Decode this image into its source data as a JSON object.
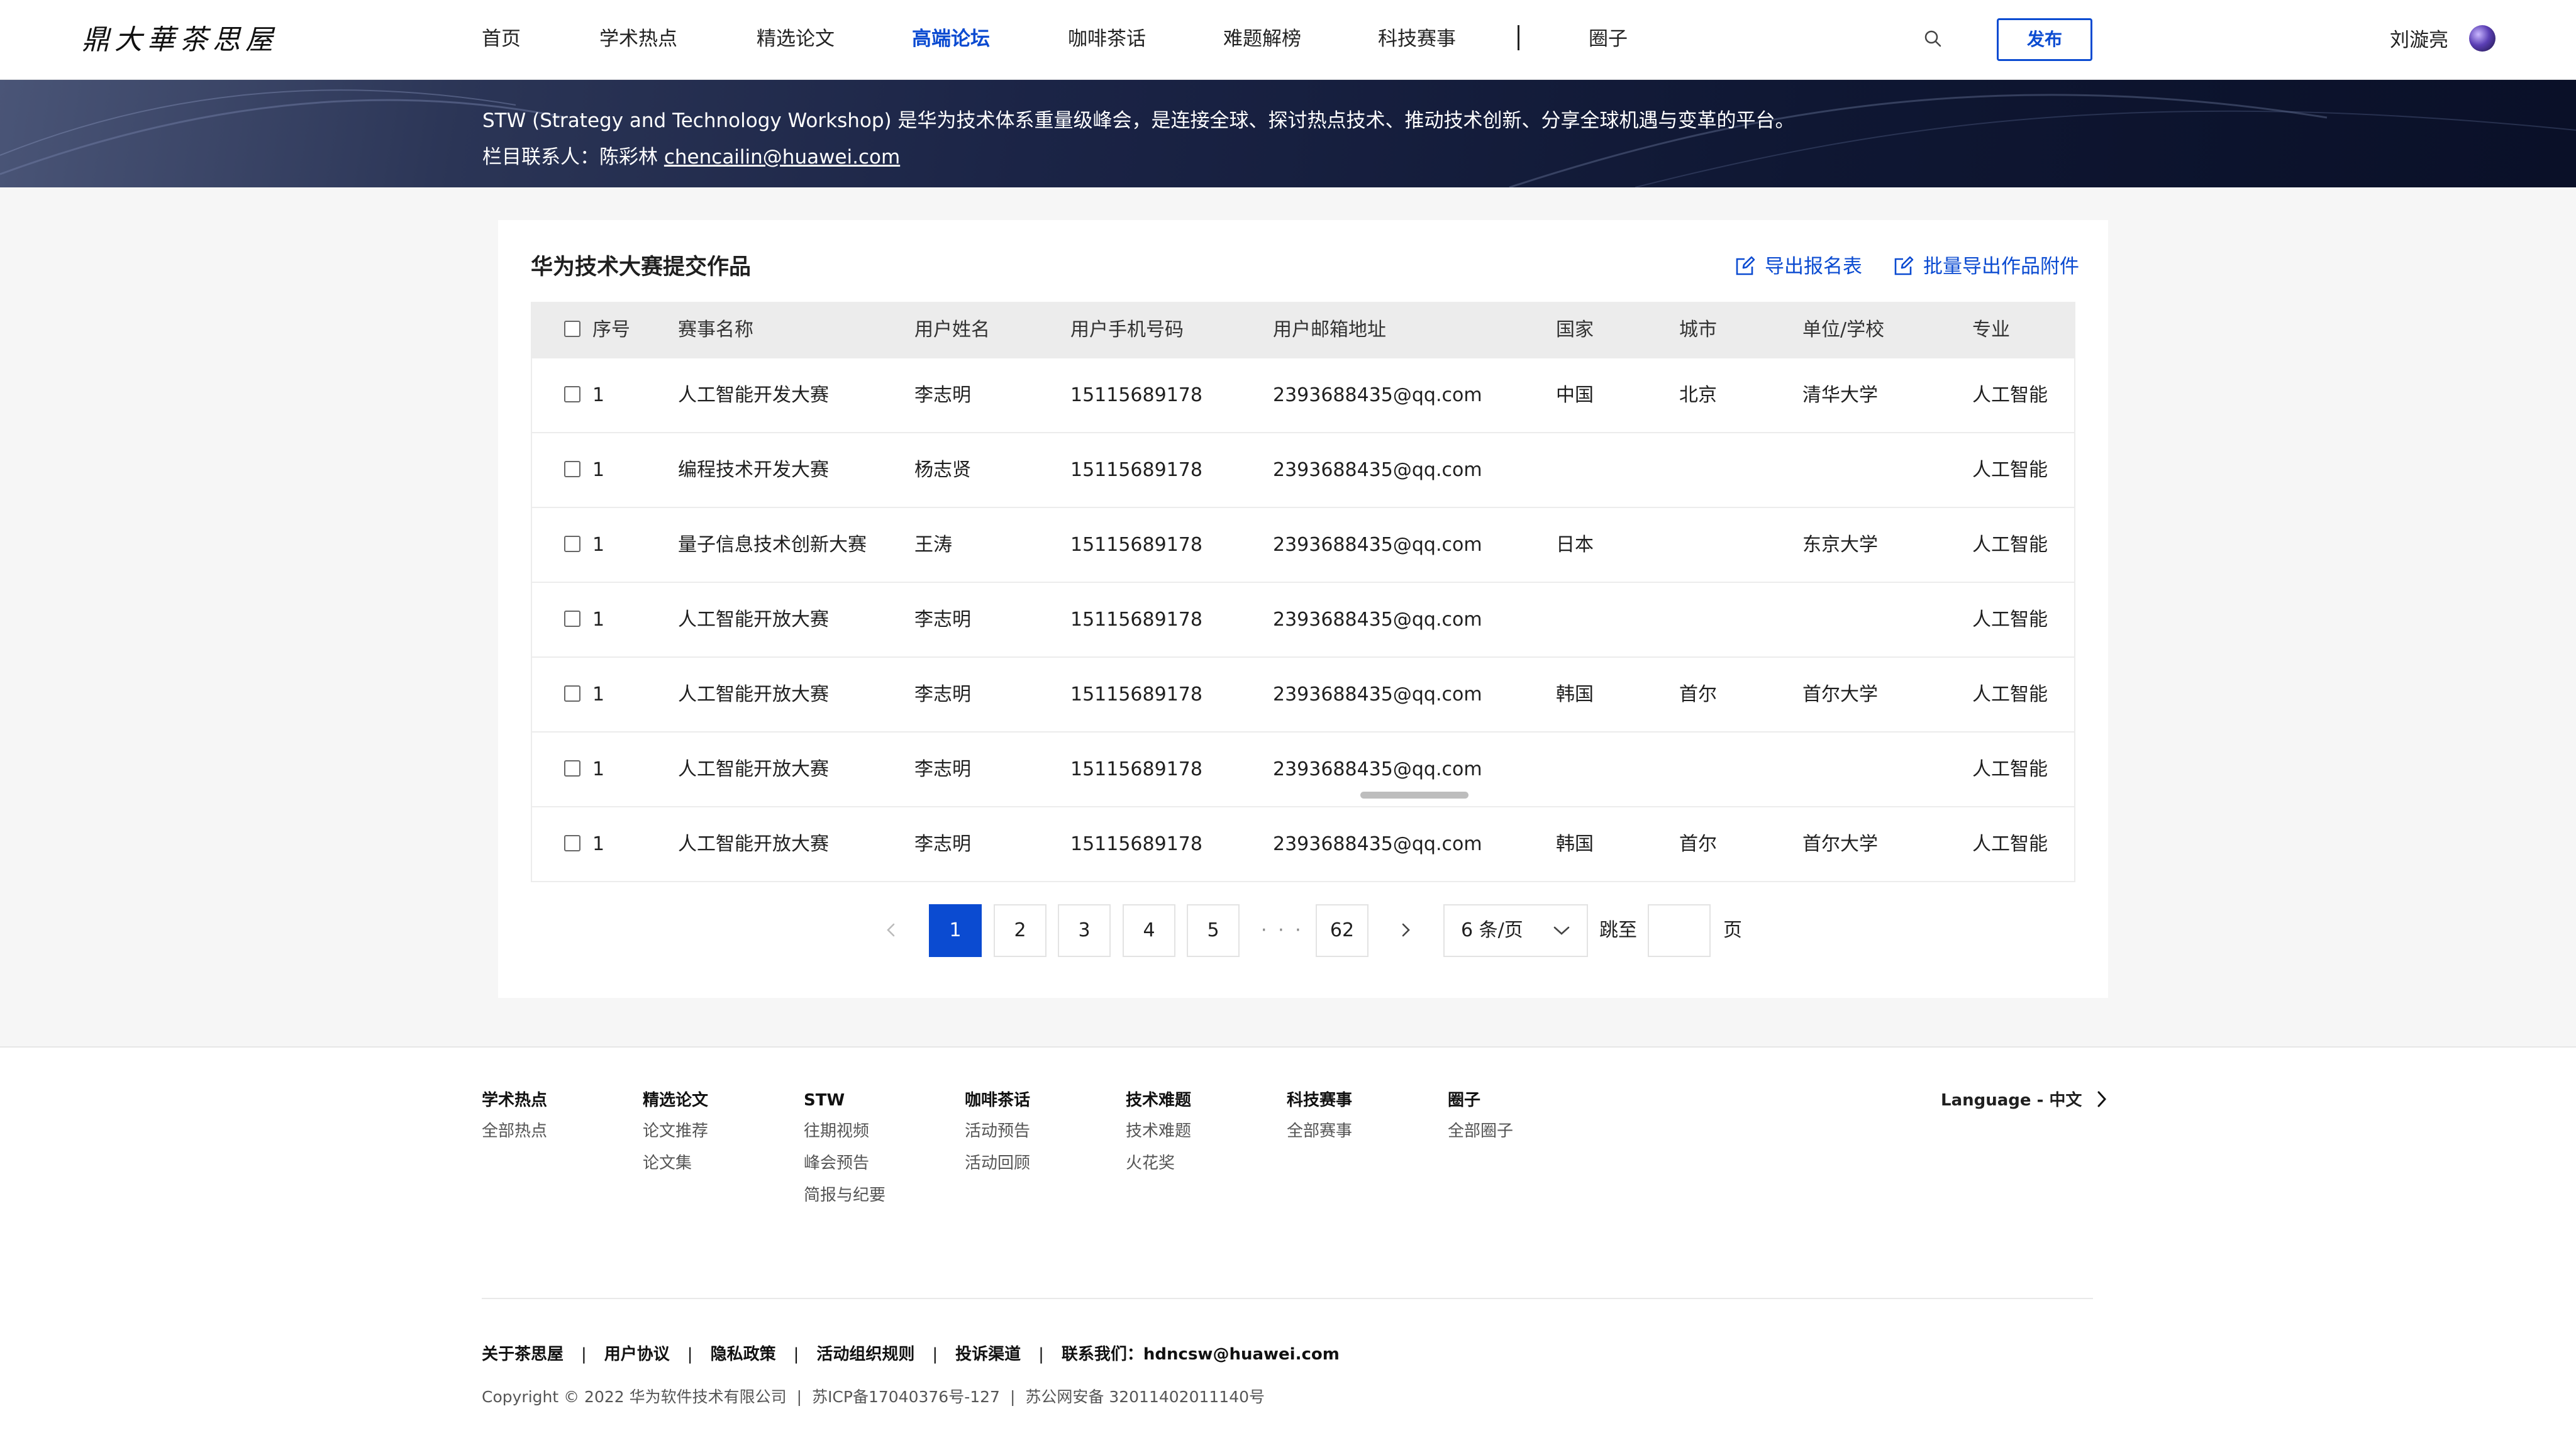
{
  "brand": {
    "logo_text": "鼎大華茶思屋"
  },
  "nav": {
    "items": [
      {
        "label": "首页"
      },
      {
        "label": "学术热点"
      },
      {
        "label": "精选论文"
      },
      {
        "label": "高端论坛",
        "active": true
      },
      {
        "label": "咖啡茶话"
      },
      {
        "label": "难题解榜"
      },
      {
        "label": "科技赛事"
      },
      {
        "label": "圈子"
      }
    ],
    "publish_label": "发布",
    "user_name": "刘漩亮"
  },
  "banner": {
    "description": "STW (Strategy and Technology Workshop) 是华为技术体系重量级峰会，是连接全球、探讨热点技术、推动技术创新、分享全球机遇与变革的平台。",
    "contact_label": "栏目联系人：陈彩林 ",
    "contact_email": "chencailin@huawei.com"
  },
  "card": {
    "title": "华为技术大赛提交作品",
    "export_registration": "导出报名表",
    "export_attachments": "批量导出作品附件"
  },
  "table": {
    "headers": [
      "序号",
      "赛事名称",
      "用户姓名",
      "用户手机号码",
      "用户邮箱地址",
      "国家",
      "城市",
      "单位/学校",
      "专业"
    ],
    "rows": [
      [
        "1",
        "人工智能开发大赛",
        "李志明",
        "15115689178",
        "2393688435@qq.com",
        "中国",
        "北京",
        "清华大学",
        "人工智能"
      ],
      [
        "1",
        "编程技术开发大赛",
        "杨志贤",
        "15115689178",
        "2393688435@qq.com",
        "",
        "",
        "",
        "人工智能"
      ],
      [
        "1",
        "量子信息技术创新大赛",
        "王涛",
        "15115689178",
        "2393688435@qq.com",
        "日本",
        "",
        "东京大学",
        "人工智能"
      ],
      [
        "1",
        "人工智能开放大赛",
        "李志明",
        "15115689178",
        "2393688435@qq.com",
        "",
        "",
        "",
        "人工智能"
      ],
      [
        "1",
        "人工智能开放大赛",
        "李志明",
        "15115689178",
        "2393688435@qq.com",
        "韩国",
        "首尔",
        "首尔大学",
        "人工智能"
      ],
      [
        "1",
        "人工智能开放大赛",
        "李志明",
        "15115689178",
        "2393688435@qq.com",
        "",
        "",
        "",
        "人工智能"
      ],
      [
        "1",
        "人工智能开放大赛",
        "李志明",
        "15115689178",
        "2393688435@qq.com",
        "韩国",
        "首尔",
        "首尔大学",
        "人工智能"
      ]
    ]
  },
  "pagination": {
    "pages": [
      "1",
      "2",
      "3",
      "4",
      "5"
    ],
    "ellipsis": "· · ·",
    "last_page": "62",
    "current_page": 1,
    "page_size": "6 条/页",
    "jump_prefix": "跳至",
    "jump_suffix": "页",
    "jump_value": ""
  },
  "footer": {
    "columns": [
      {
        "heading": "学术热点",
        "links": [
          "全部热点"
        ]
      },
      {
        "heading": "精选论文",
        "links": [
          "论文推荐",
          "论文集"
        ]
      },
      {
        "heading": "STW",
        "links": [
          "往期视频",
          "峰会预告",
          "简报与纪要"
        ]
      },
      {
        "heading": "咖啡茶话",
        "links": [
          "活动预告",
          "活动回顾"
        ]
      },
      {
        "heading": "技术难题",
        "links": [
          "技术难题",
          "火花奖"
        ]
      },
      {
        "heading": "科技赛事",
        "links": [
          "全部赛事"
        ]
      },
      {
        "heading": "圈子",
        "links": [
          "全部圈子"
        ]
      }
    ],
    "language": "Language - 中文",
    "bottom_links": [
      "关于茶思屋",
      "用户协议",
      "隐私政策",
      "活动组织规则",
      "投诉渠道"
    ],
    "contact": "联系我们：hdncsw@huawei.com",
    "copyright": "Copyright © 2022 华为软件技术有限公司",
    "icp": "苏ICP备17040376号-127",
    "police": "苏公网安备 32011402011140号"
  },
  "colors": {
    "accent": "#0b4bd1",
    "banner_dark": "#0f1733"
  }
}
